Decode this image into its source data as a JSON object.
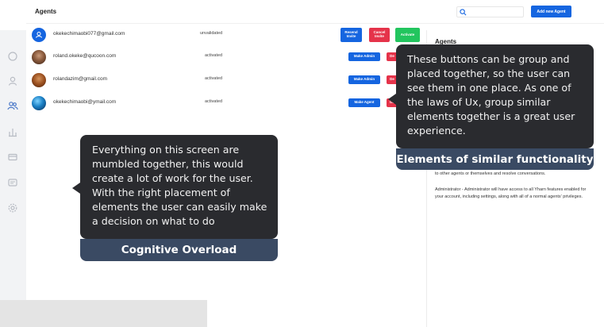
{
  "header": {
    "title": "Agents",
    "search_placeholder": "",
    "add_button": "Add new Agent"
  },
  "sidebar": {
    "icons": [
      "chat-icon",
      "user-icon",
      "team-icon",
      "chart-icon",
      "card-icon",
      "inbox-icon",
      "settings-icon"
    ]
  },
  "agents": [
    {
      "email": "okekechimaobi077@gmail.com",
      "status": "unvalidated",
      "actions": [
        "Resend Invite",
        "Cancel Invite",
        "Activate"
      ]
    },
    {
      "email": "roland.okeke@qucoon.com",
      "status": "activated",
      "actions": [
        "Make Admin",
        "De"
      ]
    },
    {
      "email": "rolandazim@gmail.com",
      "status": "activated",
      "actions": [
        "Make Admin",
        "De"
      ]
    },
    {
      "email": "okekechimaobi@ymail.com",
      "status": "activated",
      "actions": [
        "Make Agent",
        "De"
      ]
    }
  ],
  "right_panel": {
    "title": "Agents",
    "agent_text_tail": "to other agents or themselves and resolve conversations.",
    "admin_text": "Administrator - Administrator will have access to all Yharn features enabled for your account, including settings, along with all of a normal agents' privileges."
  },
  "callouts": {
    "similar": {
      "text": "These buttons can be group and placed together, so the user can see them in one place. As one of the laws of Ux, group similar elements together is a great user experience.",
      "label": "Elements of similar functionality"
    },
    "overload": {
      "text": "Everything on this screen are mumbled together, this would create a lot of work for the user. With the right placement of elements the user can easily make a decision on what to do",
      "label": "Cognitive Overload"
    }
  },
  "colors": {
    "primary": "#1565e0",
    "danger": "#e5334a",
    "success": "#22c55e",
    "callout_bg": "#2a2b2f",
    "callout_label_bg": "#3a4a63"
  }
}
